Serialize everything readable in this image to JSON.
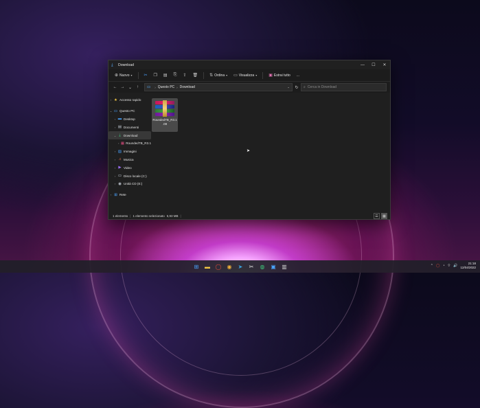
{
  "window": {
    "title": "Download"
  },
  "toolbar": {
    "new_label": "Nuovo",
    "sort_label": "Ordina",
    "view_label": "Visualizza",
    "extract_label": "Estrai tutto",
    "more_label": "..."
  },
  "address": {
    "crumbs": [
      "Questo PC",
      "Download"
    ],
    "search_placeholder": "Cerca in Download"
  },
  "sidebar": {
    "items": [
      {
        "label": "Accesso rapido",
        "icon": "star-icon"
      },
      {
        "label": "Questo PC",
        "icon": "pc-icon"
      },
      {
        "label": "Desktop",
        "icon": "desktop-icon"
      },
      {
        "label": "Documenti",
        "icon": "documents-icon"
      },
      {
        "label": "Download",
        "icon": "download-icon"
      },
      {
        "label": "RoundedTB_R3.1",
        "icon": "archive-icon"
      },
      {
        "label": "Immagini",
        "icon": "pictures-icon"
      },
      {
        "label": "Musica",
        "icon": "music-icon"
      },
      {
        "label": "Video",
        "icon": "video-icon"
      },
      {
        "label": "Disco locale (C:)",
        "icon": "drive-icon"
      },
      {
        "label": "Unità CD (E:)",
        "icon": "cd-drive-icon"
      },
      {
        "label": "Rete",
        "icon": "network-icon"
      }
    ]
  },
  "files": [
    {
      "name_line1": "RoundedTB_R3.1",
      "name_line2": ".08",
      "icon": "winrar-archive-icon"
    }
  ],
  "status": {
    "count": "1 elemento",
    "selected": "1 elemento selezionato",
    "size": "5,93 MB"
  },
  "clock": {
    "time": "21:18",
    "date": "12/04/2022"
  }
}
